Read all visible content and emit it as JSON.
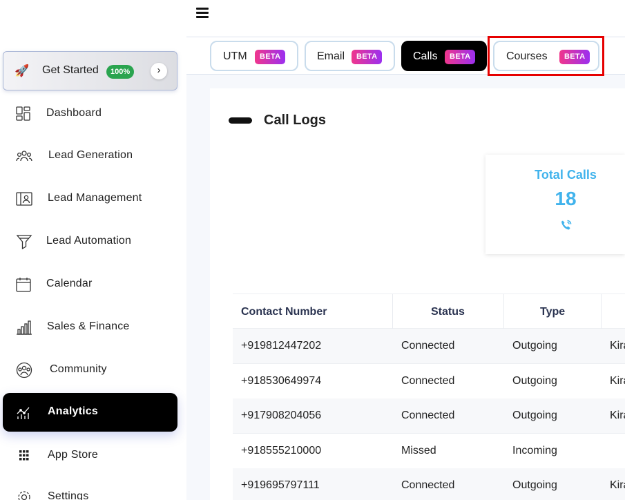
{
  "sidebar": {
    "get_started": {
      "label": "Get Started",
      "badge": "100%"
    },
    "items": [
      {
        "label": "Dashboard",
        "icon": "dashboard-icon"
      },
      {
        "label": "Lead Generation",
        "icon": "users-group-icon"
      },
      {
        "label": "Lead Management",
        "icon": "contact-card-icon"
      },
      {
        "label": "Lead Automation",
        "icon": "funnel-icon"
      },
      {
        "label": "Calendar",
        "icon": "calendar-icon"
      },
      {
        "label": "Sales & Finance",
        "icon": "bar-chart-icon"
      },
      {
        "label": "Community",
        "icon": "community-icon"
      },
      {
        "label": "Analytics",
        "icon": "analytics-icon",
        "active": true
      },
      {
        "label": "App Store",
        "icon": "apps-grid-icon"
      },
      {
        "label": "Settings",
        "icon": "gear-icon"
      }
    ]
  },
  "tabs": [
    {
      "label": "UTM",
      "badge": "BETA"
    },
    {
      "label": "Email",
      "badge": "BETA"
    },
    {
      "label": "Calls",
      "badge": "BETA",
      "active": true
    },
    {
      "label": "Courses",
      "badge": "BETA"
    }
  ],
  "card": {
    "title": "Call Logs"
  },
  "stat": {
    "label": "Total Calls",
    "value": "18",
    "icon": "phone-icon"
  },
  "table": {
    "columns": [
      "Contact Number",
      "Status",
      "Type"
    ],
    "rows": [
      {
        "number": "+919812447202",
        "status": "Connected",
        "type": "Outgoing",
        "extra": "Kira"
      },
      {
        "number": "+918530649974",
        "status": "Connected",
        "type": "Outgoing",
        "extra": "Kira"
      },
      {
        "number": "+917908204056",
        "status": "Connected",
        "type": "Outgoing",
        "extra": "Kira"
      },
      {
        "number": "+918555210000",
        "status": "Missed",
        "type": "Incoming",
        "extra": ""
      },
      {
        "number": "+919695797111",
        "status": "Connected",
        "type": "Outgoing",
        "extra": "Kira"
      }
    ]
  },
  "colors": {
    "accent": "#41b3ec",
    "beta_start": "#f0368c",
    "beta_end": "#9b2ff0",
    "badge_green": "#2aa44f",
    "highlight": "#e60000"
  }
}
